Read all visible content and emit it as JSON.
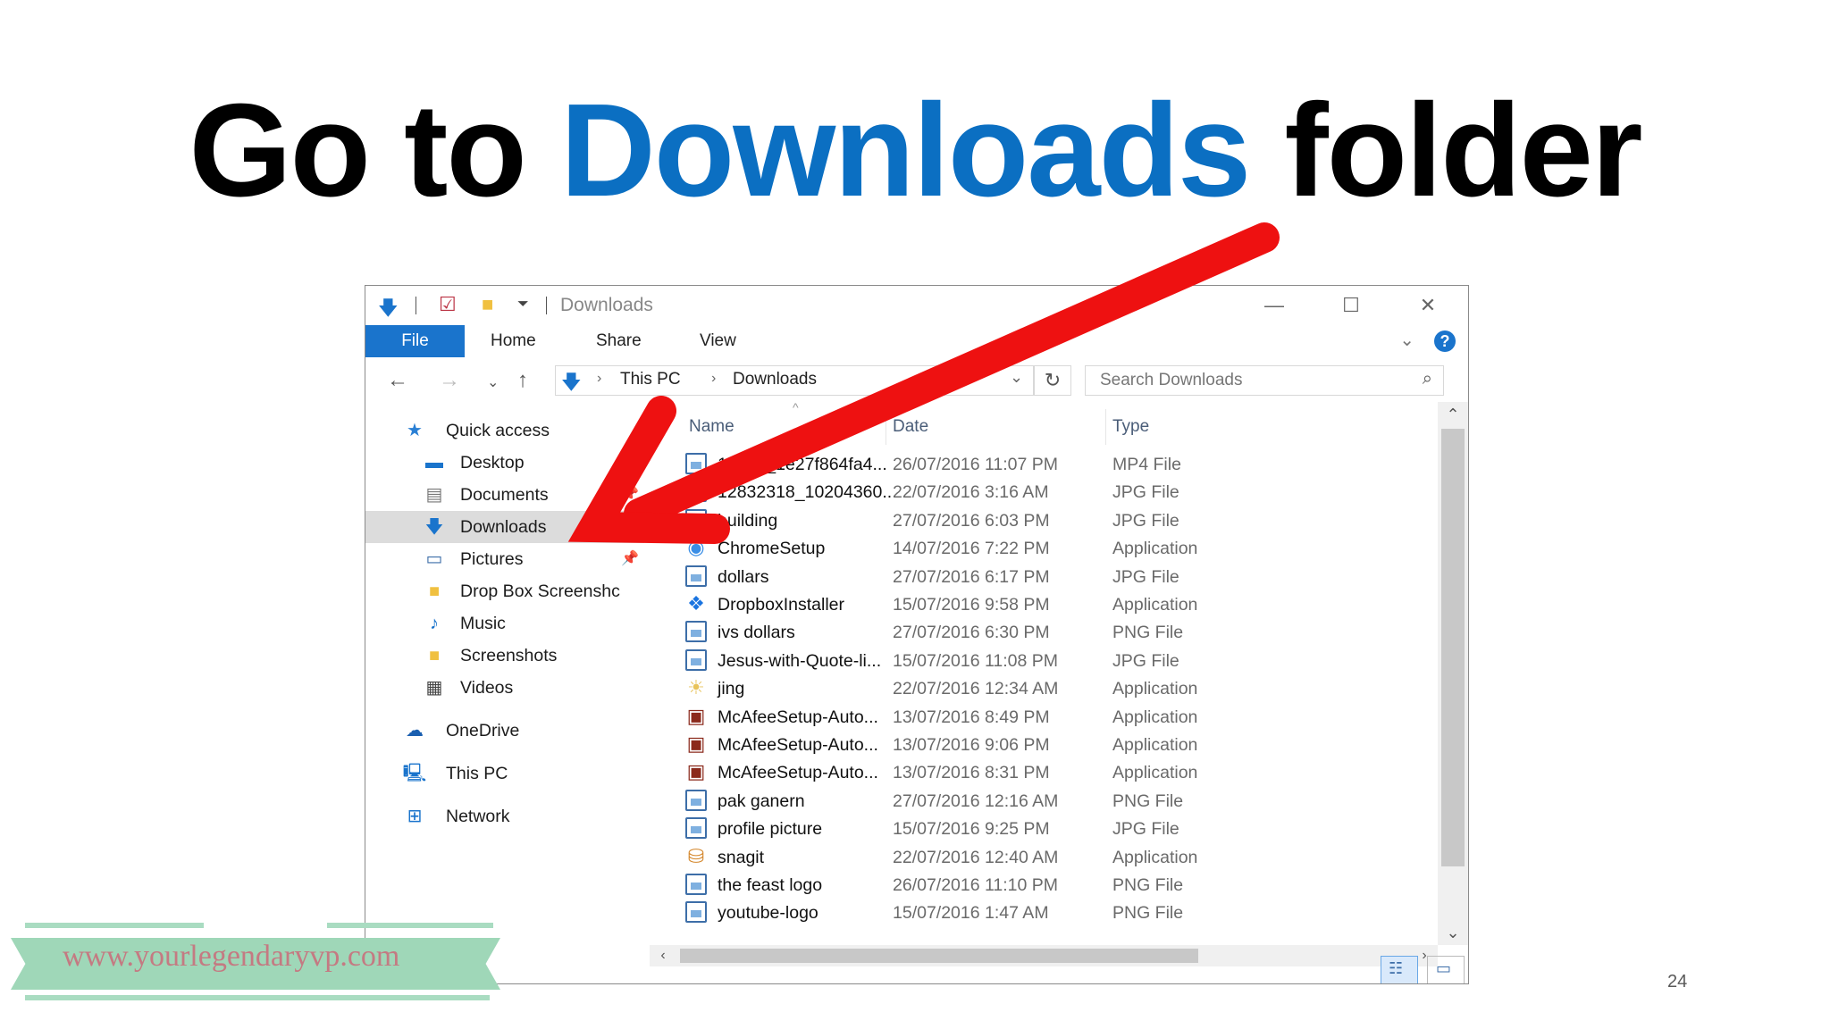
{
  "slide": {
    "title_part1": "Go to ",
    "title_highlight": "Downloads",
    "title_part2": " folder",
    "highlight_color": "#0b6fc2",
    "page_number": "24",
    "watermark": "www.yourlegendaryvp.com"
  },
  "window": {
    "title": "Downloads",
    "ribbon_tabs": [
      "File",
      "Home",
      "Share",
      "View"
    ],
    "help_label": "?",
    "breadcrumb": [
      "This PC",
      "Downloads"
    ],
    "search_placeholder": "Search Downloads"
  },
  "nav": {
    "quick_access": "Quick access",
    "items": [
      {
        "label": "Desktop",
        "icon": "desktop-icon",
        "pinned": true
      },
      {
        "label": "Documents",
        "icon": "documents-icon",
        "pinned": true
      },
      {
        "label": "Downloads",
        "icon": "downloads-icon",
        "pinned": true,
        "selected": true
      },
      {
        "label": "Pictures",
        "icon": "pictures-icon",
        "pinned": true
      },
      {
        "label": "Drop Box Screenshc",
        "icon": "folder-icon"
      },
      {
        "label": "Music",
        "icon": "music-icon"
      },
      {
        "label": "Screenshots",
        "icon": "folder-icon"
      },
      {
        "label": "Videos",
        "icon": "videos-icon"
      }
    ],
    "onedrive": "OneDrive",
    "this_pc": "This PC",
    "network": "Network"
  },
  "columns": {
    "name": "Name",
    "date": "Date",
    "type": "Type"
  },
  "files": [
    {
      "name": "13879_1e27f864fa4...",
      "date": "26/07/2016 11:07 PM",
      "type": "MP4 File",
      "icon": "video-file-icon"
    },
    {
      "name": "12832318_10204360...",
      "date": "22/07/2016 3:16 AM",
      "type": "JPG File",
      "icon": "image-file-icon"
    },
    {
      "name": "building",
      "date": "27/07/2016 6:03 PM",
      "type": "JPG File",
      "icon": "image-file-icon"
    },
    {
      "name": "ChromeSetup",
      "date": "14/07/2016 7:22 PM",
      "type": "Application",
      "icon": "chrome-setup-icon"
    },
    {
      "name": "dollars",
      "date": "27/07/2016 6:17 PM",
      "type": "JPG File",
      "icon": "image-file-icon"
    },
    {
      "name": "DropboxInstaller",
      "date": "15/07/2016 9:58 PM",
      "type": "Application",
      "icon": "dropbox-icon"
    },
    {
      "name": "ivs dollars",
      "date": "27/07/2016 6:30 PM",
      "type": "PNG File",
      "icon": "image-file-icon"
    },
    {
      "name": "Jesus-with-Quote-li...",
      "date": "15/07/2016 11:08 PM",
      "type": "JPG File",
      "icon": "image-file-icon"
    },
    {
      "name": "jing",
      "date": "22/07/2016 12:34 AM",
      "type": "Application",
      "icon": "jing-icon"
    },
    {
      "name": "McAfeeSetup-Auto...",
      "date": "13/07/2016 8:49 PM",
      "type": "Application",
      "icon": "mcafee-icon"
    },
    {
      "name": "McAfeeSetup-Auto...",
      "date": "13/07/2016 9:06 PM",
      "type": "Application",
      "icon": "mcafee-icon"
    },
    {
      "name": "McAfeeSetup-Auto...",
      "date": "13/07/2016 8:31 PM",
      "type": "Application",
      "icon": "mcafee-icon"
    },
    {
      "name": "pak ganern",
      "date": "27/07/2016 12:16 AM",
      "type": "PNG File",
      "icon": "image-file-icon"
    },
    {
      "name": "profile picture",
      "date": "15/07/2016 9:25 PM",
      "type": "JPG File",
      "icon": "image-file-icon"
    },
    {
      "name": "snagit",
      "date": "22/07/2016 12:40 AM",
      "type": "Application",
      "icon": "snagit-icon"
    },
    {
      "name": "the feast logo",
      "date": "26/07/2016 11:10 PM",
      "type": "PNG File",
      "icon": "image-file-icon"
    },
    {
      "name": "youtube-logo",
      "date": "15/07/2016 1:47 AM",
      "type": "PNG File",
      "icon": "image-file-icon"
    }
  ]
}
